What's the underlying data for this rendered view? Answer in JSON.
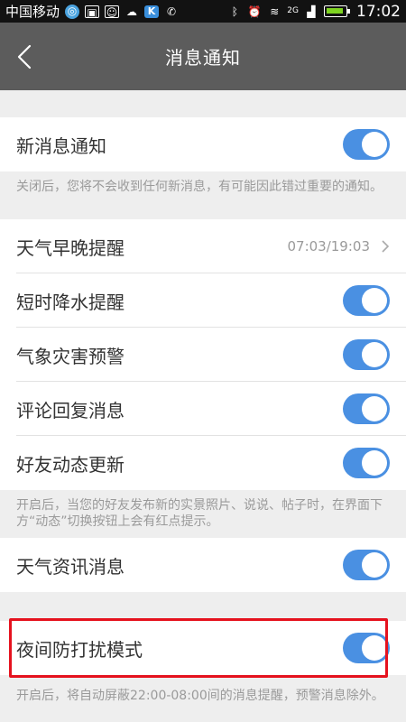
{
  "status": {
    "carrier": "中国移动",
    "signal_label": "2G",
    "time": "17:02"
  },
  "header": {
    "title": "消息通知"
  },
  "settings": {
    "new_message": {
      "label": "新消息通知",
      "enabled": true
    },
    "new_message_hint": "关闭后，您将不会收到任何新消息，有可能因此错过重要的通知。",
    "weather_reminder": {
      "label": "天气早晚提醒",
      "value": "07:03/19:03"
    },
    "rain_alert": {
      "label": "短时降水提醒",
      "enabled": true
    },
    "disaster_warning": {
      "label": "气象灾害预警",
      "enabled": true
    },
    "comment_reply": {
      "label": "评论回复消息",
      "enabled": true
    },
    "friend_updates": {
      "label": "好友动态更新",
      "enabled": true
    },
    "friend_updates_hint": "开启后，当您的好友发布新的实景照片、说说、帖子时，在界面下方“动态”切换按钮上会有红点提示。",
    "weather_news": {
      "label": "天气资讯消息",
      "enabled": true
    },
    "night_mode": {
      "label": "夜间防打扰模式",
      "enabled": true
    },
    "night_mode_hint": "开启后，将自动屏蔽22:00-08:00间的消息提醒，预警消息除外。"
  },
  "colors": {
    "toggle_on": "#4a90e2",
    "header_bg": "#5c5c5c",
    "highlight": "#e5121e"
  }
}
